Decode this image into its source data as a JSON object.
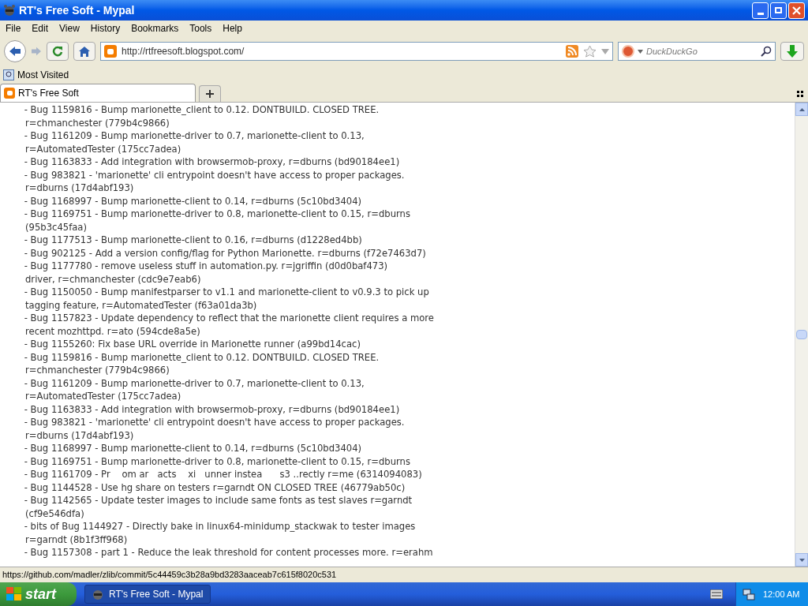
{
  "window": {
    "title": "RT's Free Soft - Mypal"
  },
  "menu": [
    "File",
    "Edit",
    "View",
    "History",
    "Bookmarks",
    "Tools",
    "Help"
  ],
  "address": {
    "url": "http://rtfreesoft.blogspot.com/"
  },
  "search": {
    "placeholder": "DuckDuckGo"
  },
  "bookmarks": [
    "Most Visited"
  ],
  "tabs": [
    {
      "label": "RT's Free Soft",
      "selected": true
    }
  ],
  "content": {
    "lines": [
      " - Bug 1159816 - Bump marionette_client to 0.12. DONTBUILD. CLOSED TREE.",
      "r=chmanchester (779b4c9866)",
      " - Bug 1161209 - Bump marionette-driver to 0.7, marionette-client to 0.13,",
      "r=AutomatedTester (175cc7adea)",
      " - Bug 1163833 - Add integration with browsermob-proxy, r=dburns (bd90184ee1)",
      " - Bug 983821 - 'marionette' cli entrypoint doesn't have access to proper packages.",
      "r=dburns (17d4abf193)",
      " - Bug 1168997 - Bump marionette-client to 0.14, r=dburns (5c10bd3404)",
      " - Bug 1169751 - Bump marionette-driver to 0.8, marionette-client to 0.15, r=dburns",
      "(95b3c45faa)",
      " - Bug 1177513 - Bump marionette-client to 0.16, r=dburns (d1228ed4bb)",
      " - Bug 902125 - Add a version config/flag for Python Marionette. r=dburns (f72e7463d7)",
      " - Bug 1177780 - remove useless stuff in automation.py. r=jgriffin (d0d0baf473)",
      "driver, r=chmanchester (cdc9e7eab6)",
      " - Bug 1150050 - Bump manifestparser to v1.1 and marionette-client to v0.9.3 to pick up",
      "tagging feature, r=AutomatedTester (f63a01da3b)",
      " - Bug 1157823 - Update dependency to reflect that the marionette client requires a more",
      "recent mozhttpd. r=ato (594cde8a5e)",
      " - Bug 1155260: Fix base URL override in Marionette runner (a99bd14cac)",
      " - Bug 1159816 - Bump marionette_client to 0.12. DONTBUILD. CLOSED TREE.",
      "r=chmanchester (779b4c9866)",
      " - Bug 1161209 - Bump marionette-driver to 0.7, marionette-client to 0.13,",
      "r=AutomatedTester (175cc7adea)",
      " - Bug 1163833 - Add integration with browsermob-proxy, r=dburns (bd90184ee1)",
      " - Bug 983821 - 'marionette' cli entrypoint doesn't have access to proper packages.",
      "r=dburns (17d4abf193)",
      " - Bug 1168997 - Bump marionette-client to 0.14, r=dburns (5c10bd3404)",
      " - Bug 1169751 - Bump marionette-driver to 0.8, marionette-client to 0.15, r=dburns",
      " - Bug 1161709 - Pr    om ar   acts    xi   unner instea      s3 ..rectly r=me (6314094083)",
      " - Bug 1144528 - Use hg share on testers r=garndt ON CLOSED TREE (46779ab50c)",
      " - Bug 1142565 - Update tester images to include same fonts as test slaves r=garndt",
      "(cf9e546dfa)",
      " - bits of Bug 1144927 - Directly bake in linux64-minidump_stackwak to tester images",
      "r=garndt (8b1f3ff968)",
      " - Bug 1157308 - part 1 - Reduce the leak threshold for content processes more. r=erahm"
    ]
  },
  "status_bar": {
    "text": "https://github.com/madler/zlib/commit/5c44459c3b28a9bd3283aaceab7c615f8020c531"
  },
  "taskbar": {
    "start": "start",
    "tasks": [
      {
        "label": "RT's Free Soft - Mypal",
        "selected": true
      }
    ],
    "clock": "12:00 AM"
  }
}
